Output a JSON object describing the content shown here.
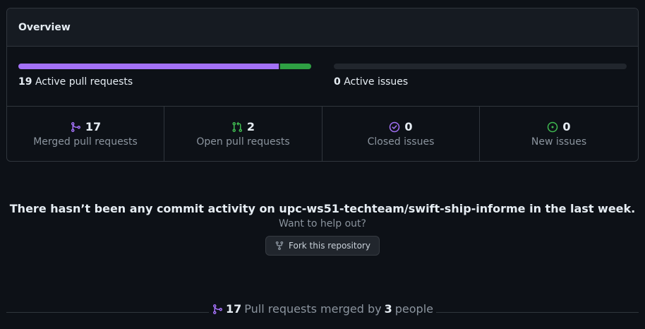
{
  "overview": {
    "title": "Overview",
    "pull_requests": {
      "count": "19",
      "label": "Active pull requests",
      "merged_fraction": 0.89,
      "open_fraction": 0.11
    },
    "issues": {
      "count": "0",
      "label": "Active issues"
    },
    "stats": [
      {
        "count": "17",
        "label": "Merged pull requests",
        "icon": "git-merge-icon",
        "color": "#a371f7"
      },
      {
        "count": "2",
        "label": "Open pull requests",
        "icon": "git-pull-request-icon",
        "color": "#3fb950"
      },
      {
        "count": "0",
        "label": "Closed issues",
        "icon": "issue-closed-icon",
        "color": "#a371f7"
      },
      {
        "count": "0",
        "label": "New issues",
        "icon": "issue-opened-icon",
        "color": "#3fb950"
      }
    ]
  },
  "commit_activity": {
    "message": "There hasn’t been any commit activity on upc-ws51-techteam/swift-ship-informe in the last week.",
    "help_text": "Want to help out?",
    "fork_button": "Fork this repository"
  },
  "merged_summary": {
    "count": "17",
    "text_mid": "Pull requests merged by",
    "people_count": "3",
    "text_end": "people"
  },
  "colors": {
    "merged": "#a371f7",
    "open": "#3fb950",
    "background": "#0d1117",
    "border": "#30363d"
  }
}
